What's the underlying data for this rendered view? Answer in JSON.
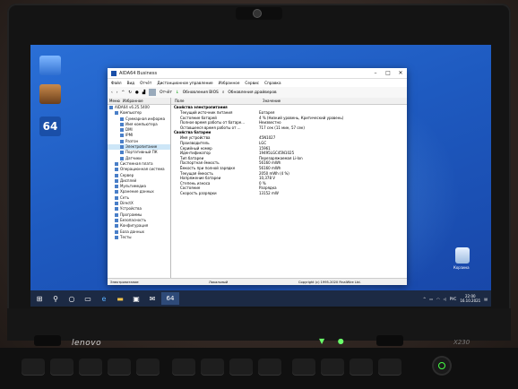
{
  "window": {
    "title": "AIDA64 Business",
    "menu": [
      "Файл",
      "Вид",
      "Отчёт",
      "Дистанционное управление",
      "Избранное",
      "Сервис",
      "Справка"
    ],
    "toolbar": {
      "report": "Отчёт",
      "bios": "Обновления BIOS",
      "drivers": "Обновления драйверов"
    },
    "left_tabs": [
      "Меню",
      "Избранное"
    ],
    "tree": [
      {
        "label": "AIDA64 v6.25.5400",
        "indent": 0,
        "sel": false
      },
      {
        "label": "Компьютер",
        "indent": 1,
        "sel": false
      },
      {
        "label": "Суммарная информа",
        "indent": 2,
        "sel": false
      },
      {
        "label": "Имя компьютера",
        "indent": 2,
        "sel": false
      },
      {
        "label": "DMI",
        "indent": 2,
        "sel": false
      },
      {
        "label": "IPMI",
        "indent": 2,
        "sel": false
      },
      {
        "label": "Разгон",
        "indent": 2,
        "sel": false
      },
      {
        "label": "Электропитание",
        "indent": 2,
        "sel": true
      },
      {
        "label": "Портативный ПК",
        "indent": 2,
        "sel": false
      },
      {
        "label": "Датчики",
        "indent": 2,
        "sel": false
      },
      {
        "label": "Системная плата",
        "indent": 1,
        "sel": false
      },
      {
        "label": "Операционная система",
        "indent": 1,
        "sel": false
      },
      {
        "label": "Сервер",
        "indent": 1,
        "sel": false
      },
      {
        "label": "Дисплей",
        "indent": 1,
        "sel": false
      },
      {
        "label": "Мультимедиа",
        "indent": 1,
        "sel": false
      },
      {
        "label": "Хранение данных",
        "indent": 1,
        "sel": false
      },
      {
        "label": "Сеть",
        "indent": 1,
        "sel": false
      },
      {
        "label": "DirectX",
        "indent": 1,
        "sel": false
      },
      {
        "label": "Устройства",
        "indent": 1,
        "sel": false
      },
      {
        "label": "Программы",
        "indent": 1,
        "sel": false
      },
      {
        "label": "Безопасность",
        "indent": 1,
        "sel": false
      },
      {
        "label": "Конфигурация",
        "indent": 1,
        "sel": false
      },
      {
        "label": "База данных",
        "indent": 1,
        "sel": false
      },
      {
        "label": "Тесты",
        "indent": 1,
        "sel": false
      }
    ],
    "columns": [
      "Поле",
      "Значение"
    ],
    "groups": [
      {
        "title": "Свойства электропитания",
        "rows": [
          {
            "f": "Текущий источник питания",
            "v": "Батарея"
          },
          {
            "f": "Состояние батарей",
            "v": "4 % (Низкий уровень, Критический уровень)"
          },
          {
            "f": "Полное время работы от батаре...",
            "v": "Неизвестно"
          },
          {
            "f": "Оставшееся время работы от ...",
            "v": "717 сек (11 мин, 57 сек)"
          }
        ]
      },
      {
        "title": "Свойства батареи",
        "rows": [
          {
            "f": "Имя устройства",
            "v": "45N1027"
          },
          {
            "f": "Производитель",
            "v": "LGC"
          },
          {
            "f": "Серийный номер",
            "v": "15961"
          },
          {
            "f": "Идентификатор",
            "v": "19495LGC45N1025"
          },
          {
            "f": "Тип батареи",
            "v": "Перезаряжаемая Li-Ion"
          },
          {
            "f": "Паспортная ёмкость",
            "v": "56160 mWh"
          },
          {
            "f": "Ёмкость при полной зарядке",
            "v": "56160 mWh"
          },
          {
            "f": "Текущая ёмкость",
            "v": "2050 mWh (4 %)"
          },
          {
            "f": "Напряжение батареи",
            "v": "10,378 V"
          },
          {
            "f": "Степень износа",
            "v": "0 %"
          },
          {
            "f": "Состояние",
            "v": "Разрядка"
          },
          {
            "f": "Скорость разрядки",
            "v": "13152 mW"
          }
        ]
      }
    ],
    "status": {
      "left": "Электропитание",
      "mid": "Локальный",
      "right": "Copyright (c) 1995-2020 FinalWire Ltd."
    }
  },
  "desktop": {
    "aida_label": "64",
    "recycle_label": "Корзина"
  },
  "taskbar": {
    "lang": "РУС",
    "time": "22:00",
    "date": "16.10.2021",
    "app": "64"
  },
  "laptop": {
    "brand": "lenovo",
    "model": "X230"
  },
  "colors": {
    "wallpaper": "#1e5ac0",
    "taskbar": "#1c2a44",
    "selection": "#cde6f7",
    "led": "#6aff6a"
  }
}
